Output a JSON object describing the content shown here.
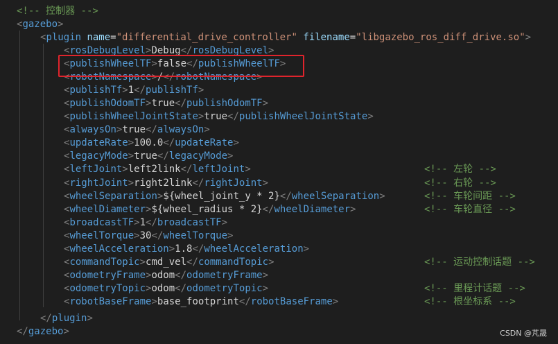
{
  "header_comment": "<!-- 控制器 -->",
  "gazebo_open": "gazebo",
  "gazebo_close": "gazebo",
  "plugin": {
    "tag": "plugin",
    "attr_name": "name",
    "name_value": "\"differential_drive_controller\"",
    "attr_filename": "filename",
    "filename_value": "\"libgazebo_ros_diff_drive.so\""
  },
  "params": [
    {
      "tag": "rosDebugLevel",
      "value": "Debug",
      "comment": ""
    },
    {
      "tag": "publishWheelTF",
      "value": "false",
      "comment": ""
    },
    {
      "tag": "robotNamespace",
      "value": "/",
      "comment": ""
    },
    {
      "tag": "publishTf",
      "value": "1",
      "comment": ""
    },
    {
      "tag": "publishOdomTF",
      "value": "true",
      "comment": ""
    },
    {
      "tag": "publishWheelJointState",
      "value": "true",
      "comment": ""
    },
    {
      "tag": "alwaysOn",
      "value": "true",
      "comment": ""
    },
    {
      "tag": "updateRate",
      "value": "100.0",
      "comment": ""
    },
    {
      "tag": "legacyMode",
      "value": "true",
      "comment": ""
    },
    {
      "tag": "leftJoint",
      "value": "left2link",
      "comment": "<!-- 左轮 -->"
    },
    {
      "tag": "rightJoint",
      "value": "right2link",
      "comment": "<!-- 右轮 -->"
    },
    {
      "tag": "wheelSeparation",
      "value": "${wheel_joint_y * 2}",
      "comment": "<!-- 车轮间距 -->"
    },
    {
      "tag": "wheelDiameter",
      "value": "${wheel_radius * 2}",
      "comment": "<!-- 车轮直径 -->"
    },
    {
      "tag": "broadcastTF",
      "value": "1",
      "comment": ""
    },
    {
      "tag": "wheelTorque",
      "value": "30",
      "comment": ""
    },
    {
      "tag": "wheelAcceleration",
      "value": "1.8",
      "comment": ""
    },
    {
      "tag": "commandTopic",
      "value": "cmd_vel",
      "comment": "<!-- 运动控制话题 -->"
    },
    {
      "tag": "odometryFrame",
      "value": "odom",
      "comment": ""
    },
    {
      "tag": "odometryTopic",
      "value": "odom",
      "comment": "<!-- 里程计话题 -->"
    },
    {
      "tag": "robotBaseFrame",
      "value": "base_footprint",
      "comment": "<!-- 根坐标系 -->"
    }
  ],
  "watermark": "CSDN @芃晟",
  "colors": {
    "background": "#1e1e1e",
    "comment": "#6a9955",
    "tag": "#569cd6",
    "attribute": "#9cdcfe",
    "string": "#ce9178",
    "text": "#d4d4d4",
    "bracket": "#808080",
    "highlight": "#e0242c"
  }
}
